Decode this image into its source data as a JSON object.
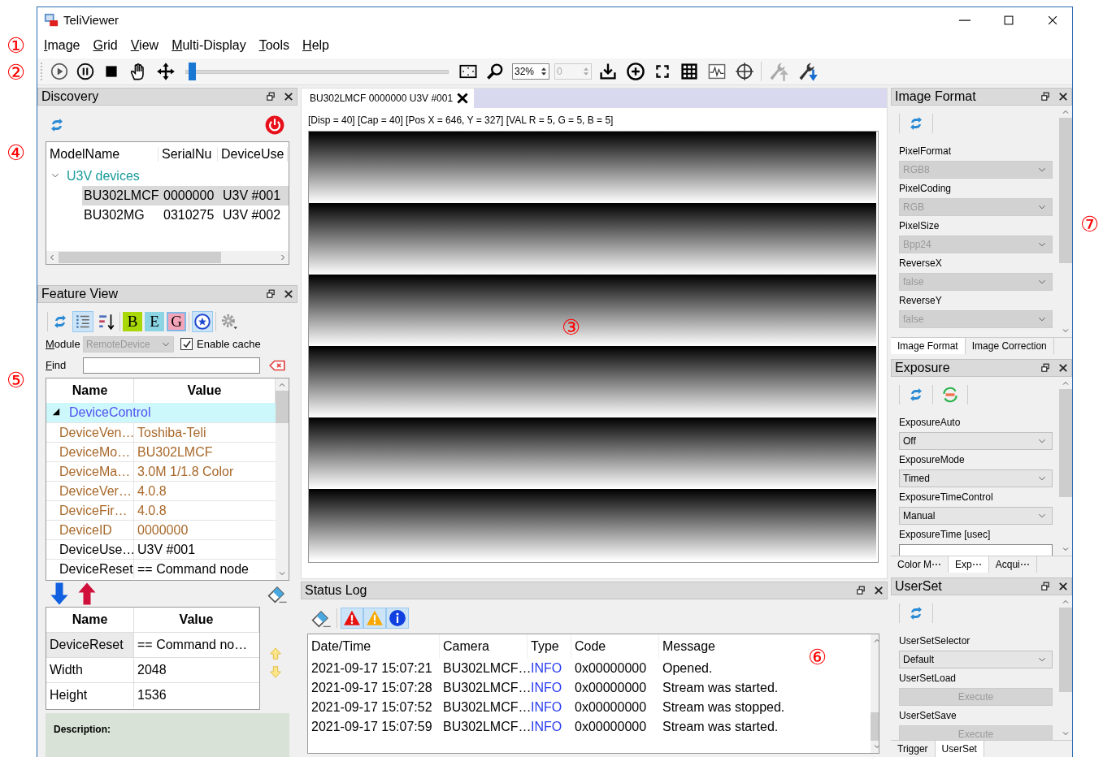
{
  "window": {
    "title": "TeliViewer"
  },
  "menu": {
    "marker": "①",
    "items": [
      "Image",
      "Grid",
      "View",
      "Multi-Display",
      "Tools",
      "Help"
    ]
  },
  "toolbar": {
    "marker": "②",
    "slider": {
      "level": 0.01
    },
    "zoom": {
      "value": "32%"
    },
    "frame": {
      "value": "0",
      "disabled": true
    },
    "tools": [
      {
        "kind": "upload",
        "disabled": true
      },
      {
        "kind": "download",
        "disabled": false
      }
    ]
  },
  "discovery": {
    "title": "Discovery",
    "marker": "④",
    "columns": [
      "ModelName",
      "SerialNu",
      "DeviceUse"
    ],
    "groups": [
      {
        "label": "U3V devices",
        "expanded": true,
        "children": [
          {
            "model": "BU302LMCF",
            "serial": "0000000",
            "user": "U3V #001",
            "selected": true
          },
          {
            "model": "BU302MG",
            "serial": "0310275",
            "user": "U3V #002",
            "selected": false
          }
        ]
      }
    ]
  },
  "feature_view": {
    "title": "Feature View",
    "marker": "⑤",
    "view_buttons": [
      {
        "kind": "tree",
        "selected": true
      },
      {
        "kind": "sort",
        "selected": false
      }
    ],
    "levels": [
      {
        "label": "B",
        "color": "#a8d808",
        "selected": false
      },
      {
        "label": "E",
        "color": "#8ad4e4",
        "selected": false
      },
      {
        "label": "G",
        "color": "#f4a4b8",
        "selected": true
      }
    ],
    "polling": {
      "selected": true
    },
    "module": {
      "label": "Module",
      "value": "RemoteDevice",
      "disabled": true
    },
    "cache": {
      "label": "Enable cache",
      "checked": true
    },
    "find": {
      "label": "Find"
    },
    "tree": {
      "columns": [
        "Name",
        "Value"
      ],
      "categories": [
        {
          "label": "DeviceControl",
          "expanded": true,
          "children": [
            {
              "name": "DeviceVen…",
              "value": "Toshiba-Teli",
              "read_only": true
            },
            {
              "name": "DeviceMo…",
              "value": "BU302LMCF",
              "read_only": true
            },
            {
              "name": "DeviceMa…",
              "value": "3.0M 1/1.8 Color",
              "read_only": true
            },
            {
              "name": "DeviceVer…",
              "value": "4.0.8",
              "read_only": true
            },
            {
              "name": "DeviceFir…",
              "value": "4.0.8",
              "read_only": true
            },
            {
              "name": "DeviceID",
              "value": "0000000",
              "read_only": true
            },
            {
              "name": "DeviceUse…",
              "value": "U3V #001",
              "read_only": false
            },
            {
              "name": "DeviceReset",
              "value": "== Command node",
              "read_only": false
            }
          ]
        }
      ]
    },
    "watch": {
      "columns": [
        "Name",
        "Value"
      ],
      "rows": [
        {
          "name": "DeviceReset",
          "value": "== Command no…",
          "selected": true
        },
        {
          "name": "Width",
          "value": "2048",
          "selected": false
        },
        {
          "name": "Height",
          "value": "1536",
          "selected": false
        }
      ]
    },
    "description": {
      "label": "Description:"
    }
  },
  "image_view": {
    "marker": "③",
    "tabs": [
      {
        "label": "BU302LMCF 0000000 U3V #001",
        "selected": true
      }
    ],
    "info": "[Disp = 40] [Cap = 40] [Pos X = 646, Y = 327] [VAL R = 5, G = 5, B = 5]"
  },
  "status_log": {
    "title": "Status Log",
    "marker": "⑥",
    "filters": [
      {
        "kind": "error",
        "selected": true
      },
      {
        "kind": "warning",
        "selected": true
      },
      {
        "kind": "info",
        "selected": true
      }
    ],
    "columns": [
      "Date/Time",
      "Camera",
      "Type",
      "Code",
      "Message"
    ],
    "rows": [
      {
        "time": "2021-09-17 15:07:21",
        "camera": "BU302LMCF…",
        "type": "INFO",
        "code": "0x00000000",
        "message": "Opened."
      },
      {
        "time": "2021-09-17 15:07:28",
        "camera": "BU302LMCF…",
        "type": "INFO",
        "code": "0x00000000",
        "message": "Stream was started."
      },
      {
        "time": "2021-09-17 15:07:52",
        "camera": "BU302LMCF…",
        "type": "INFO",
        "code": "0x00000000",
        "message": "Stream was stopped."
      },
      {
        "time": "2021-09-17 15:07:59",
        "camera": "BU302LMCF…",
        "type": "INFO",
        "code": "0x00000000",
        "message": "Stream was started."
      }
    ]
  },
  "feature_panels": [
    {
      "title": "Image Format",
      "marker": "⑦",
      "icons": [
        {
          "kind": "refresh"
        }
      ],
      "fields": [
        {
          "label": "PixelFormat",
          "kind": "select",
          "value": "RGB8",
          "disabled": true
        },
        {
          "label": "PixelCoding",
          "kind": "select",
          "value": "RGB",
          "disabled": true
        },
        {
          "label": "PixelSize",
          "kind": "select",
          "value": "Bpp24",
          "disabled": true
        },
        {
          "label": "ReverseX",
          "kind": "select",
          "value": "false",
          "disabled": true
        },
        {
          "label": "ReverseY",
          "kind": "select",
          "value": "false",
          "disabled": true
        }
      ],
      "tabs": [
        {
          "label": "Image Format",
          "selected": true
        },
        {
          "label": "Image Correction",
          "selected": false
        }
      ]
    },
    {
      "title": "Exposure",
      "icons": [
        {
          "kind": "refresh"
        },
        {
          "kind": "auto"
        }
      ],
      "fields": [
        {
          "label": "ExposureAuto",
          "kind": "select",
          "value": "Off",
          "disabled": false
        },
        {
          "label": "ExposureMode",
          "kind": "select",
          "value": "Timed",
          "disabled": false
        },
        {
          "label": "ExposureTimeControl",
          "kind": "select",
          "value": "Manual",
          "disabled": false
        },
        {
          "label": "ExposureTime [usec]",
          "kind": "input",
          "disabled": false
        }
      ],
      "tabs": [
        {
          "label": "Color M⋯",
          "selected": false
        },
        {
          "label": "Exp⋯",
          "selected": true
        },
        {
          "label": "Acqui⋯",
          "selected": false
        }
      ]
    },
    {
      "title": "UserSet",
      "icons": [
        {
          "kind": "refresh"
        }
      ],
      "fields": [
        {
          "label": "UserSetSelector",
          "kind": "select",
          "value": "Default",
          "disabled": false
        },
        {
          "label": "UserSetLoad",
          "kind": "button",
          "value": "Execute",
          "disabled": true
        },
        {
          "label": "UserSetSave",
          "kind": "button",
          "value": "Execute",
          "disabled": true
        }
      ],
      "tabs": [
        {
          "label": "Trigger",
          "selected": false
        },
        {
          "label": "UserSet",
          "selected": true
        }
      ]
    }
  ]
}
